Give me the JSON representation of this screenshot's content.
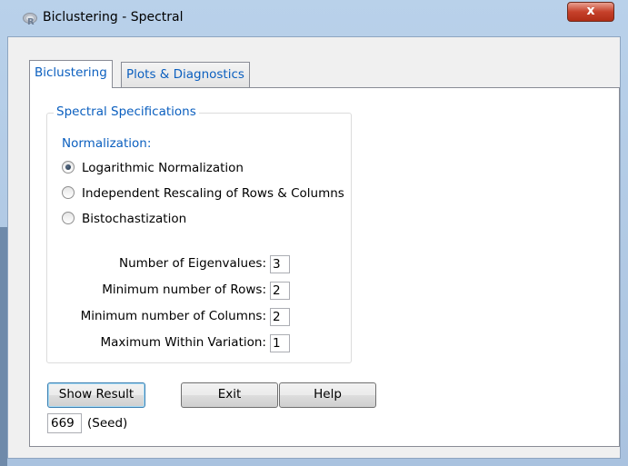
{
  "window": {
    "title": "Biclustering - Spectral",
    "close_label": "x"
  },
  "tabs": [
    {
      "label": "Biclustering",
      "active": true
    },
    {
      "label": "Plots & Diagnostics",
      "active": false
    }
  ],
  "spec_group": {
    "title": "Spectral Specifications",
    "normalization_label": "Normalization:",
    "options": [
      {
        "label": "Logarithmic Normalization",
        "checked": true
      },
      {
        "label": "Independent Rescaling of Rows & Columns",
        "checked": false
      },
      {
        "label": "Bistochastization",
        "checked": false
      }
    ],
    "fields": [
      {
        "label": "Number of Eigenvalues:",
        "value": "3"
      },
      {
        "label": "Minimum number of Rows:",
        "value": "2"
      },
      {
        "label": "Minimum number of Columns:",
        "value": "2"
      },
      {
        "label": "Maximum Within Variation:",
        "value": "1"
      }
    ]
  },
  "buttons": {
    "show_result": "Show Result",
    "exit": "Exit",
    "help": "Help"
  },
  "seed": {
    "value": "669",
    "label": "(Seed)"
  }
}
